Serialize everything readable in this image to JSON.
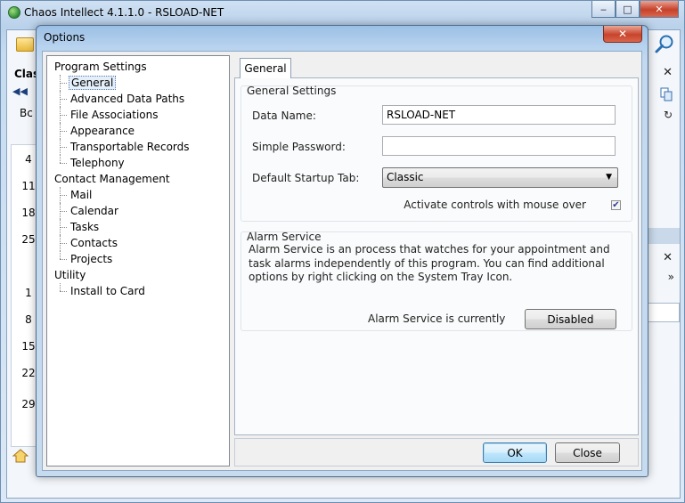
{
  "main_window": {
    "title": "Chaos Intellect 4.1.1.0 - RSLOAD-NET",
    "caption_minimize": "‒",
    "caption_maximize": "□",
    "caption_close": "✕",
    "partial_tab": "Class",
    "partial_label": "Bc",
    "day_numbers": [
      "4",
      "11",
      "18",
      "25",
      "1",
      "8",
      "15",
      "22",
      "29"
    ],
    "nav_arrows": "◀◀",
    "close_x_1": "✕",
    "close_x_2": "✕",
    "more_chevron": "»"
  },
  "dialog": {
    "title": "Options",
    "close": "✕",
    "tree": [
      {
        "label": "Program Settings",
        "level": 0
      },
      {
        "label": "General",
        "level": 1,
        "selected": true
      },
      {
        "label": "Advanced Data Paths",
        "level": 1
      },
      {
        "label": "File Associations",
        "level": 1
      },
      {
        "label": "Appearance",
        "level": 1
      },
      {
        "label": "Transportable Records",
        "level": 1
      },
      {
        "label": "Telephony",
        "level": 1,
        "last": true
      },
      {
        "label": "Contact Management",
        "level": 0
      },
      {
        "label": "Mail",
        "level": 1
      },
      {
        "label": "Calendar",
        "level": 1
      },
      {
        "label": "Tasks",
        "level": 1
      },
      {
        "label": "Contacts",
        "level": 1
      },
      {
        "label": "Projects",
        "level": 1,
        "last": true
      },
      {
        "label": "Utility",
        "level": 0
      },
      {
        "label": "Install to Card",
        "level": 1,
        "last": true
      }
    ],
    "tab": "General",
    "general_settings": {
      "title": "General Settings",
      "data_name_label": "Data Name:",
      "data_name_value": "RSLOAD-NET",
      "password_label": "Simple Password:",
      "password_value": "",
      "startup_tab_label": "Default Startup Tab:",
      "startup_tab_value": "Classic",
      "activate_label": "Activate controls with mouse over",
      "activate_checked": true,
      "check_mark": "✔"
    },
    "alarm_service": {
      "title": "Alarm Service",
      "description": "Alarm Service is an process that watches for your appointment and task alarms independently of this program.  You can find additional options by right clicking on the System Tray Icon.",
      "status_label": "Alarm Service is currently",
      "status_button": "Disabled"
    },
    "ok_button": "OK",
    "close_button": "Close"
  }
}
